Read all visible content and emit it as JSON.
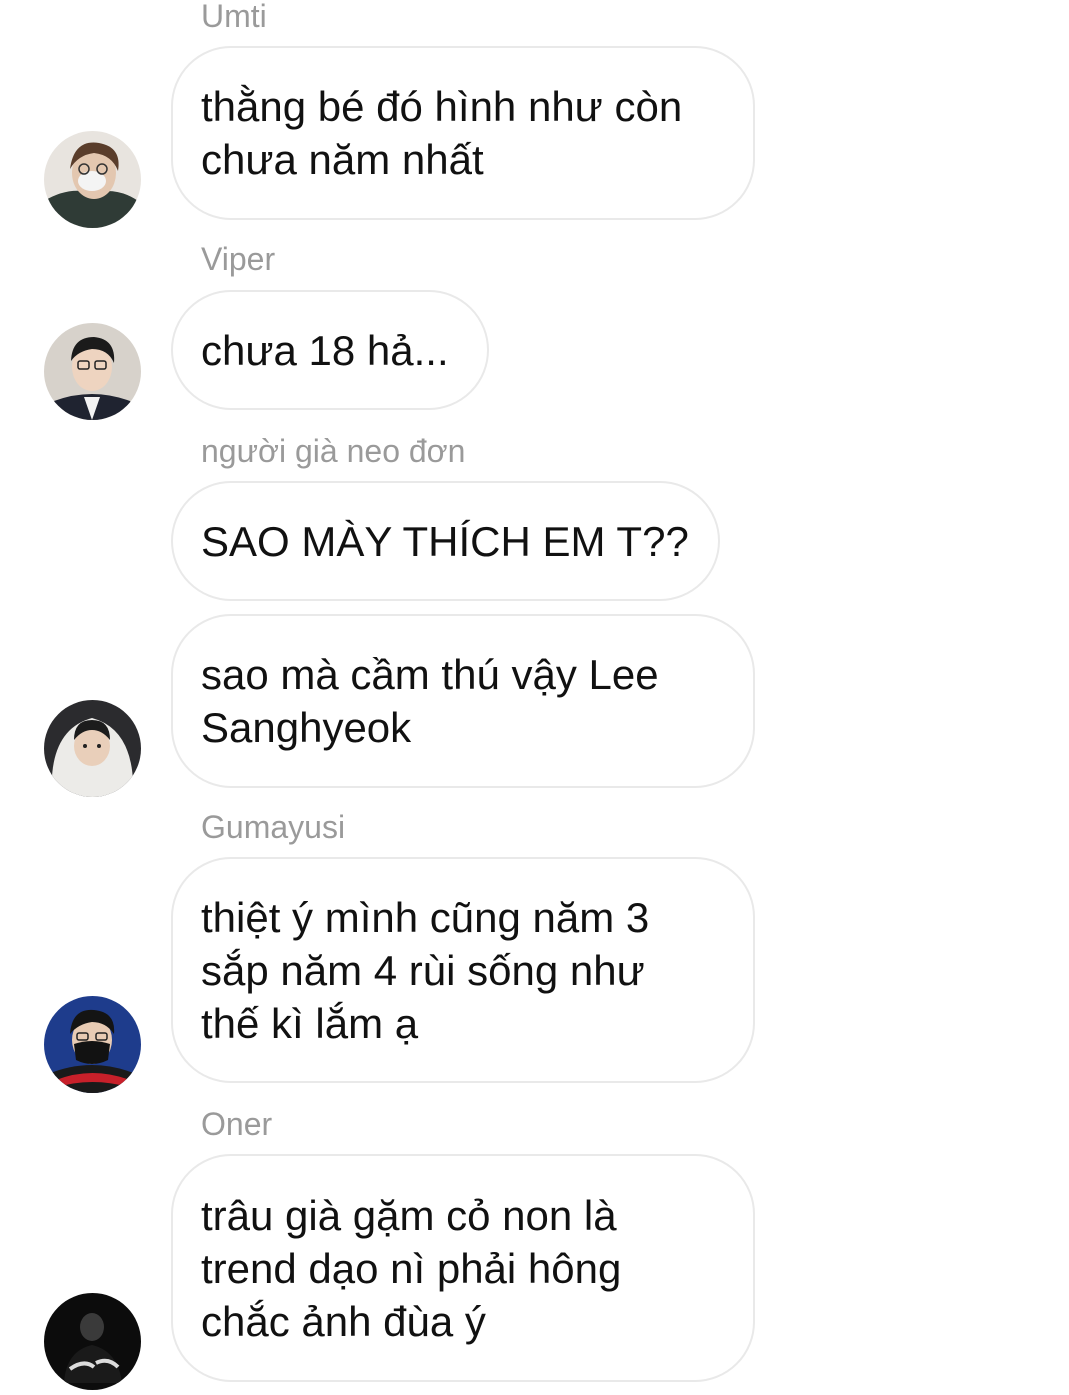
{
  "messages": [
    {
      "sender": "Umti",
      "text": "thằng bé đó hình như còn\nchưa năm nhất"
    },
    {
      "sender": "Viper",
      "text": "chưa 18 hả..."
    },
    {
      "sender": "người già neo đơn",
      "text": "SAO MÀY THÍCH EM T??"
    },
    {
      "sender": "",
      "text": "sao mà cầm thú vậy Lee\nSanghyeok"
    },
    {
      "sender": "Gumayusi",
      "text": "thiệt ý mình cũng năm 3\nsắp năm 4 rùi sống như\nthế kì lắm ạ"
    },
    {
      "sender": "Oner",
      "text": "trâu già gặm cỏ non là\ntrend dạo nì phải hông\nchắc ảnh đùa ý"
    }
  ],
  "colors": {
    "sender_name": "#9a9a9a",
    "bubble_border": "#e9e9e9",
    "message_text": "#111111"
  }
}
